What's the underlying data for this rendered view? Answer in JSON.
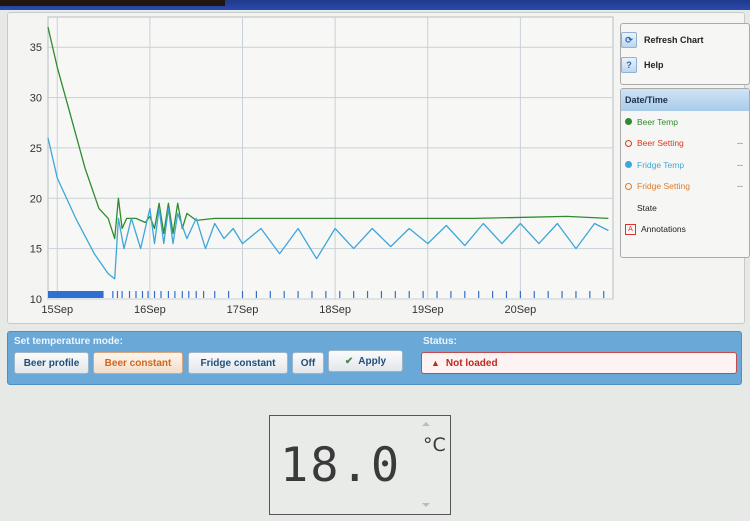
{
  "colors": {
    "beer_temp": "#2e8b2e",
    "beer_setting": "#d93a1e",
    "fridge_temp": "#3fa6d8",
    "fridge_setting": "#e07a2c",
    "annotations": "#d33333",
    "state_bar": "#2f6fd1",
    "active_mode": "#d2661a",
    "status_error": "#c0281e"
  },
  "sidebar": {
    "refresh_label": "Refresh Chart",
    "refresh_icon": "refresh-icon",
    "help_label": "Help",
    "help_icon": "question-icon"
  },
  "legend": {
    "header": "Date/Time",
    "items": [
      {
        "label": "Beer Temp",
        "color": "#2e8b2e",
        "marker": "filled-dot",
        "value": ""
      },
      {
        "label": "Beer Setting",
        "color": "#d93a1e",
        "marker": "hollow-dot",
        "value": "--"
      },
      {
        "label": "Fridge Temp",
        "color": "#3fa6d8",
        "marker": "filled-dot",
        "value": "--"
      },
      {
        "label": "Fridge Setting",
        "color": "#e07a2c",
        "marker": "hollow-dot",
        "value": "--"
      },
      {
        "label": "State",
        "color": "#222222",
        "marker": "none",
        "value": ""
      },
      {
        "label": "Annotations",
        "color": "#d33333",
        "marker": "a-box",
        "value": ""
      }
    ]
  },
  "chart_data": {
    "type": "line",
    "title": "",
    "xlabel": "",
    "ylabel": "",
    "x_ticks": [
      "15Sep",
      "16Sep",
      "17Sep",
      "18Sep",
      "19Sep",
      "20Sep"
    ],
    "y_ticks": [
      10,
      15,
      20,
      25,
      30,
      35
    ],
    "ylim": [
      10,
      38
    ],
    "xlim": [
      14.9,
      21.0
    ],
    "grid": true,
    "series": [
      {
        "name": "Beer Temp",
        "color": "#2e8b2e",
        "points": [
          [
            14.9,
            37.0
          ],
          [
            15.0,
            33.0
          ],
          [
            15.15,
            28.0
          ],
          [
            15.3,
            23.0
          ],
          [
            15.45,
            19.0
          ],
          [
            15.55,
            18.0
          ],
          [
            15.62,
            16.0
          ],
          [
            15.66,
            20.0
          ],
          [
            15.7,
            17.0
          ],
          [
            15.75,
            18.0
          ],
          [
            15.85,
            18.0
          ],
          [
            15.95,
            17.6
          ],
          [
            16.0,
            18.2
          ],
          [
            16.05,
            17.0
          ],
          [
            16.1,
            19.5
          ],
          [
            16.15,
            16.5
          ],
          [
            16.2,
            19.5
          ],
          [
            16.25,
            16.5
          ],
          [
            16.3,
            19.5
          ],
          [
            16.35,
            17.0
          ],
          [
            16.4,
            18.5
          ],
          [
            16.5,
            17.8
          ],
          [
            16.7,
            18.0
          ],
          [
            17.5,
            18.0
          ],
          [
            18.5,
            18.0
          ],
          [
            19.5,
            18.0
          ],
          [
            20.5,
            18.2
          ],
          [
            20.95,
            18.0
          ]
        ]
      },
      {
        "name": "Fridge Temp",
        "color": "#3fa6d8",
        "points": [
          [
            14.9,
            26.0
          ],
          [
            15.0,
            22.0
          ],
          [
            15.2,
            18.0
          ],
          [
            15.4,
            14.5
          ],
          [
            15.55,
            12.5
          ],
          [
            15.62,
            12.0
          ],
          [
            15.66,
            18.0
          ],
          [
            15.72,
            15.0
          ],
          [
            15.8,
            18.0
          ],
          [
            15.9,
            15.0
          ],
          [
            16.0,
            19.0
          ],
          [
            16.05,
            15.5
          ],
          [
            16.1,
            19.0
          ],
          [
            16.15,
            15.5
          ],
          [
            16.2,
            19.0
          ],
          [
            16.25,
            15.5
          ],
          [
            16.3,
            18.5
          ],
          [
            16.4,
            16.0
          ],
          [
            16.5,
            18.0
          ],
          [
            16.6,
            15.0
          ],
          [
            16.7,
            17.5
          ],
          [
            16.8,
            16.0
          ],
          [
            16.9,
            17.0
          ],
          [
            17.0,
            15.5
          ],
          [
            17.2,
            17.0
          ],
          [
            17.4,
            14.5
          ],
          [
            17.6,
            17.0
          ],
          [
            17.8,
            14.0
          ],
          [
            18.0,
            17.0
          ],
          [
            18.2,
            15.0
          ],
          [
            18.4,
            17.0
          ],
          [
            18.6,
            15.2
          ],
          [
            18.8,
            17.0
          ],
          [
            19.0,
            15.5
          ],
          [
            19.2,
            17.3
          ],
          [
            19.4,
            15.3
          ],
          [
            19.6,
            17.5
          ],
          [
            19.8,
            15.5
          ],
          [
            20.0,
            17.5
          ],
          [
            20.2,
            15.5
          ],
          [
            20.4,
            17.5
          ],
          [
            20.6,
            15.0
          ],
          [
            20.8,
            17.5
          ],
          [
            20.95,
            16.8
          ]
        ]
      }
    ],
    "state_band": {
      "name": "State",
      "color": "#2f6fd1",
      "solid_range": [
        14.9,
        15.5
      ],
      "marks": [
        15.6,
        15.65,
        15.7,
        15.78,
        15.85,
        15.92,
        15.98,
        16.05,
        16.12,
        16.2,
        16.27,
        16.35,
        16.42,
        16.5,
        16.58,
        16.7,
        16.85,
        17.0,
        17.15,
        17.3,
        17.45,
        17.6,
        17.75,
        17.9,
        18.05,
        18.2,
        18.35,
        18.5,
        18.65,
        18.8,
        18.95,
        19.1,
        19.25,
        19.4,
        19.55,
        19.7,
        19.85,
        20.0,
        20.15,
        20.3,
        20.45,
        20.6,
        20.75,
        20.9
      ]
    }
  },
  "controls": {
    "mode_label": "Set temperature mode:",
    "status_label": "Status:",
    "modes": [
      {
        "label": "Beer profile",
        "active": false
      },
      {
        "label": "Beer constant",
        "active": true
      },
      {
        "label": "Fridge constant",
        "active": false
      },
      {
        "label": "Off",
        "active": false
      }
    ],
    "apply_label": "Apply",
    "status_text": "Not loaded"
  },
  "display": {
    "value": "18.0",
    "unit": "°C"
  }
}
